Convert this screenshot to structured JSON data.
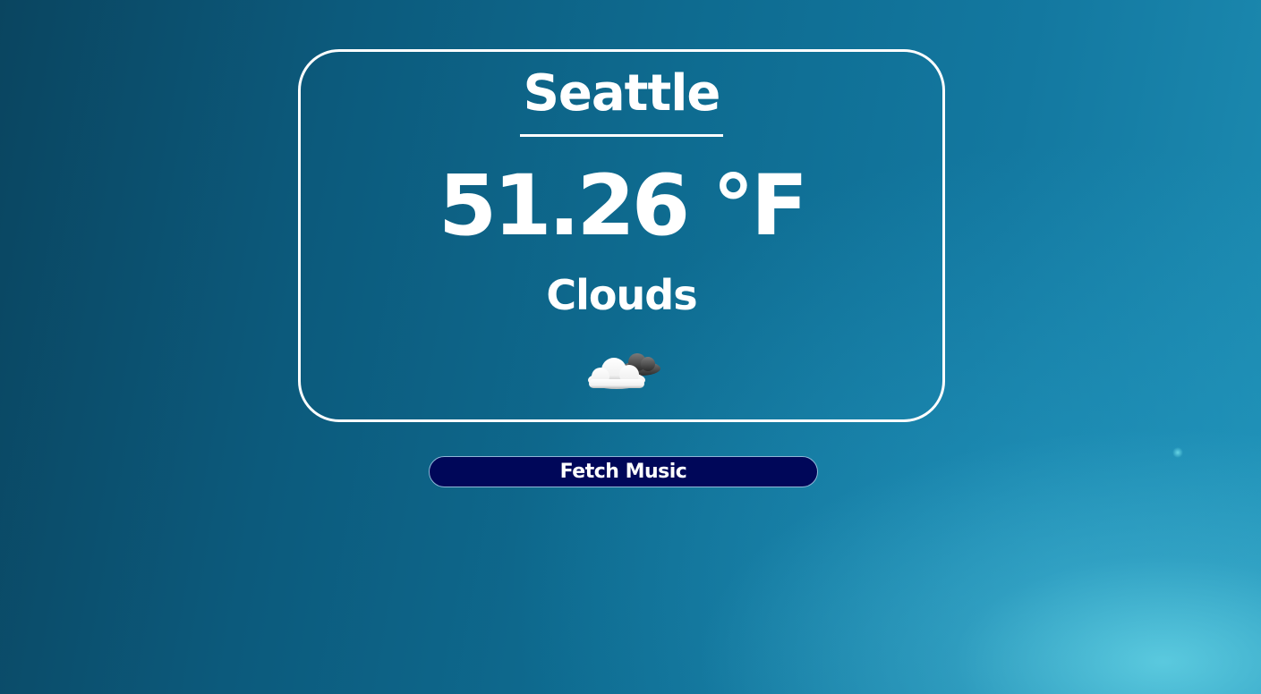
{
  "weather": {
    "city": "Seattle",
    "temperature": "51.26 °F",
    "condition": "Clouds",
    "icon": "cloud-icon"
  },
  "actions": {
    "fetch_music_label": "Fetch Music"
  },
  "colors": {
    "button_background": "#000759",
    "card_border": "#ffffff",
    "text": "#ffffff"
  }
}
